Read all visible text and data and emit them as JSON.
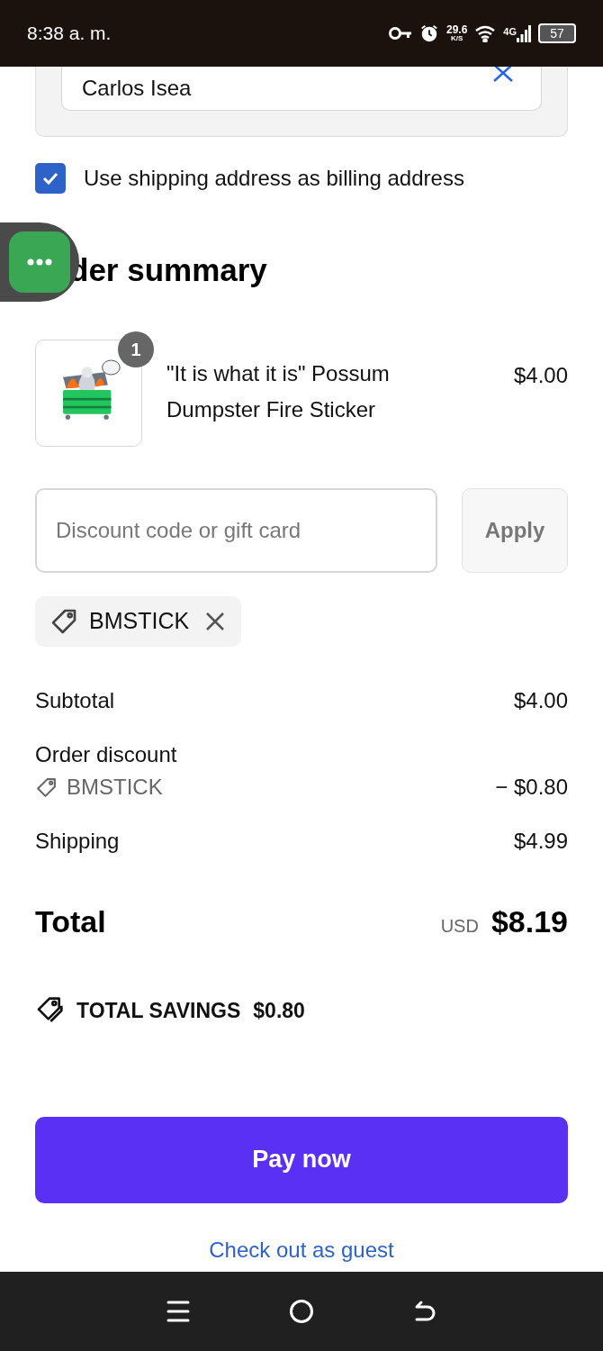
{
  "status_bar": {
    "time": "8:38 a. m.",
    "speed_value": "29.6",
    "speed_unit": "K/S",
    "network": "4G",
    "battery": "57"
  },
  "name_field": {
    "value": "Carlos Isea"
  },
  "billing_checkbox": {
    "label": "Use shipping address as billing address",
    "checked": true
  },
  "heading": "der summary",
  "items": [
    {
      "kind": "picture",
      "quantity": "1",
      "name": "\"It is what it is\" Possum Dumpster Fire Sticker",
      "price": "$4.00"
    }
  ],
  "discount": {
    "placeholder": "Discount code or gift card",
    "button": "Apply"
  },
  "applied_codes": [
    {
      "code": "BMSTICK"
    }
  ],
  "summary": [
    {
      "kind": "line",
      "label": "Subtotal",
      "amount": "$4.00"
    },
    {
      "kind": "heading",
      "label": "Order discount"
    },
    {
      "kind": "code",
      "label": "BMSTICK",
      "amount": "− $0.80"
    },
    {
      "kind": "line",
      "label": "Shipping",
      "amount": "$4.99"
    }
  ],
  "total": {
    "label": "Total",
    "currency": "USD",
    "amount": "$8.19"
  },
  "savings": {
    "label": "TOTAL SAVINGS",
    "amount": "$0.80"
  },
  "pay_button": "Pay now",
  "guest_link": "Check out as guest"
}
